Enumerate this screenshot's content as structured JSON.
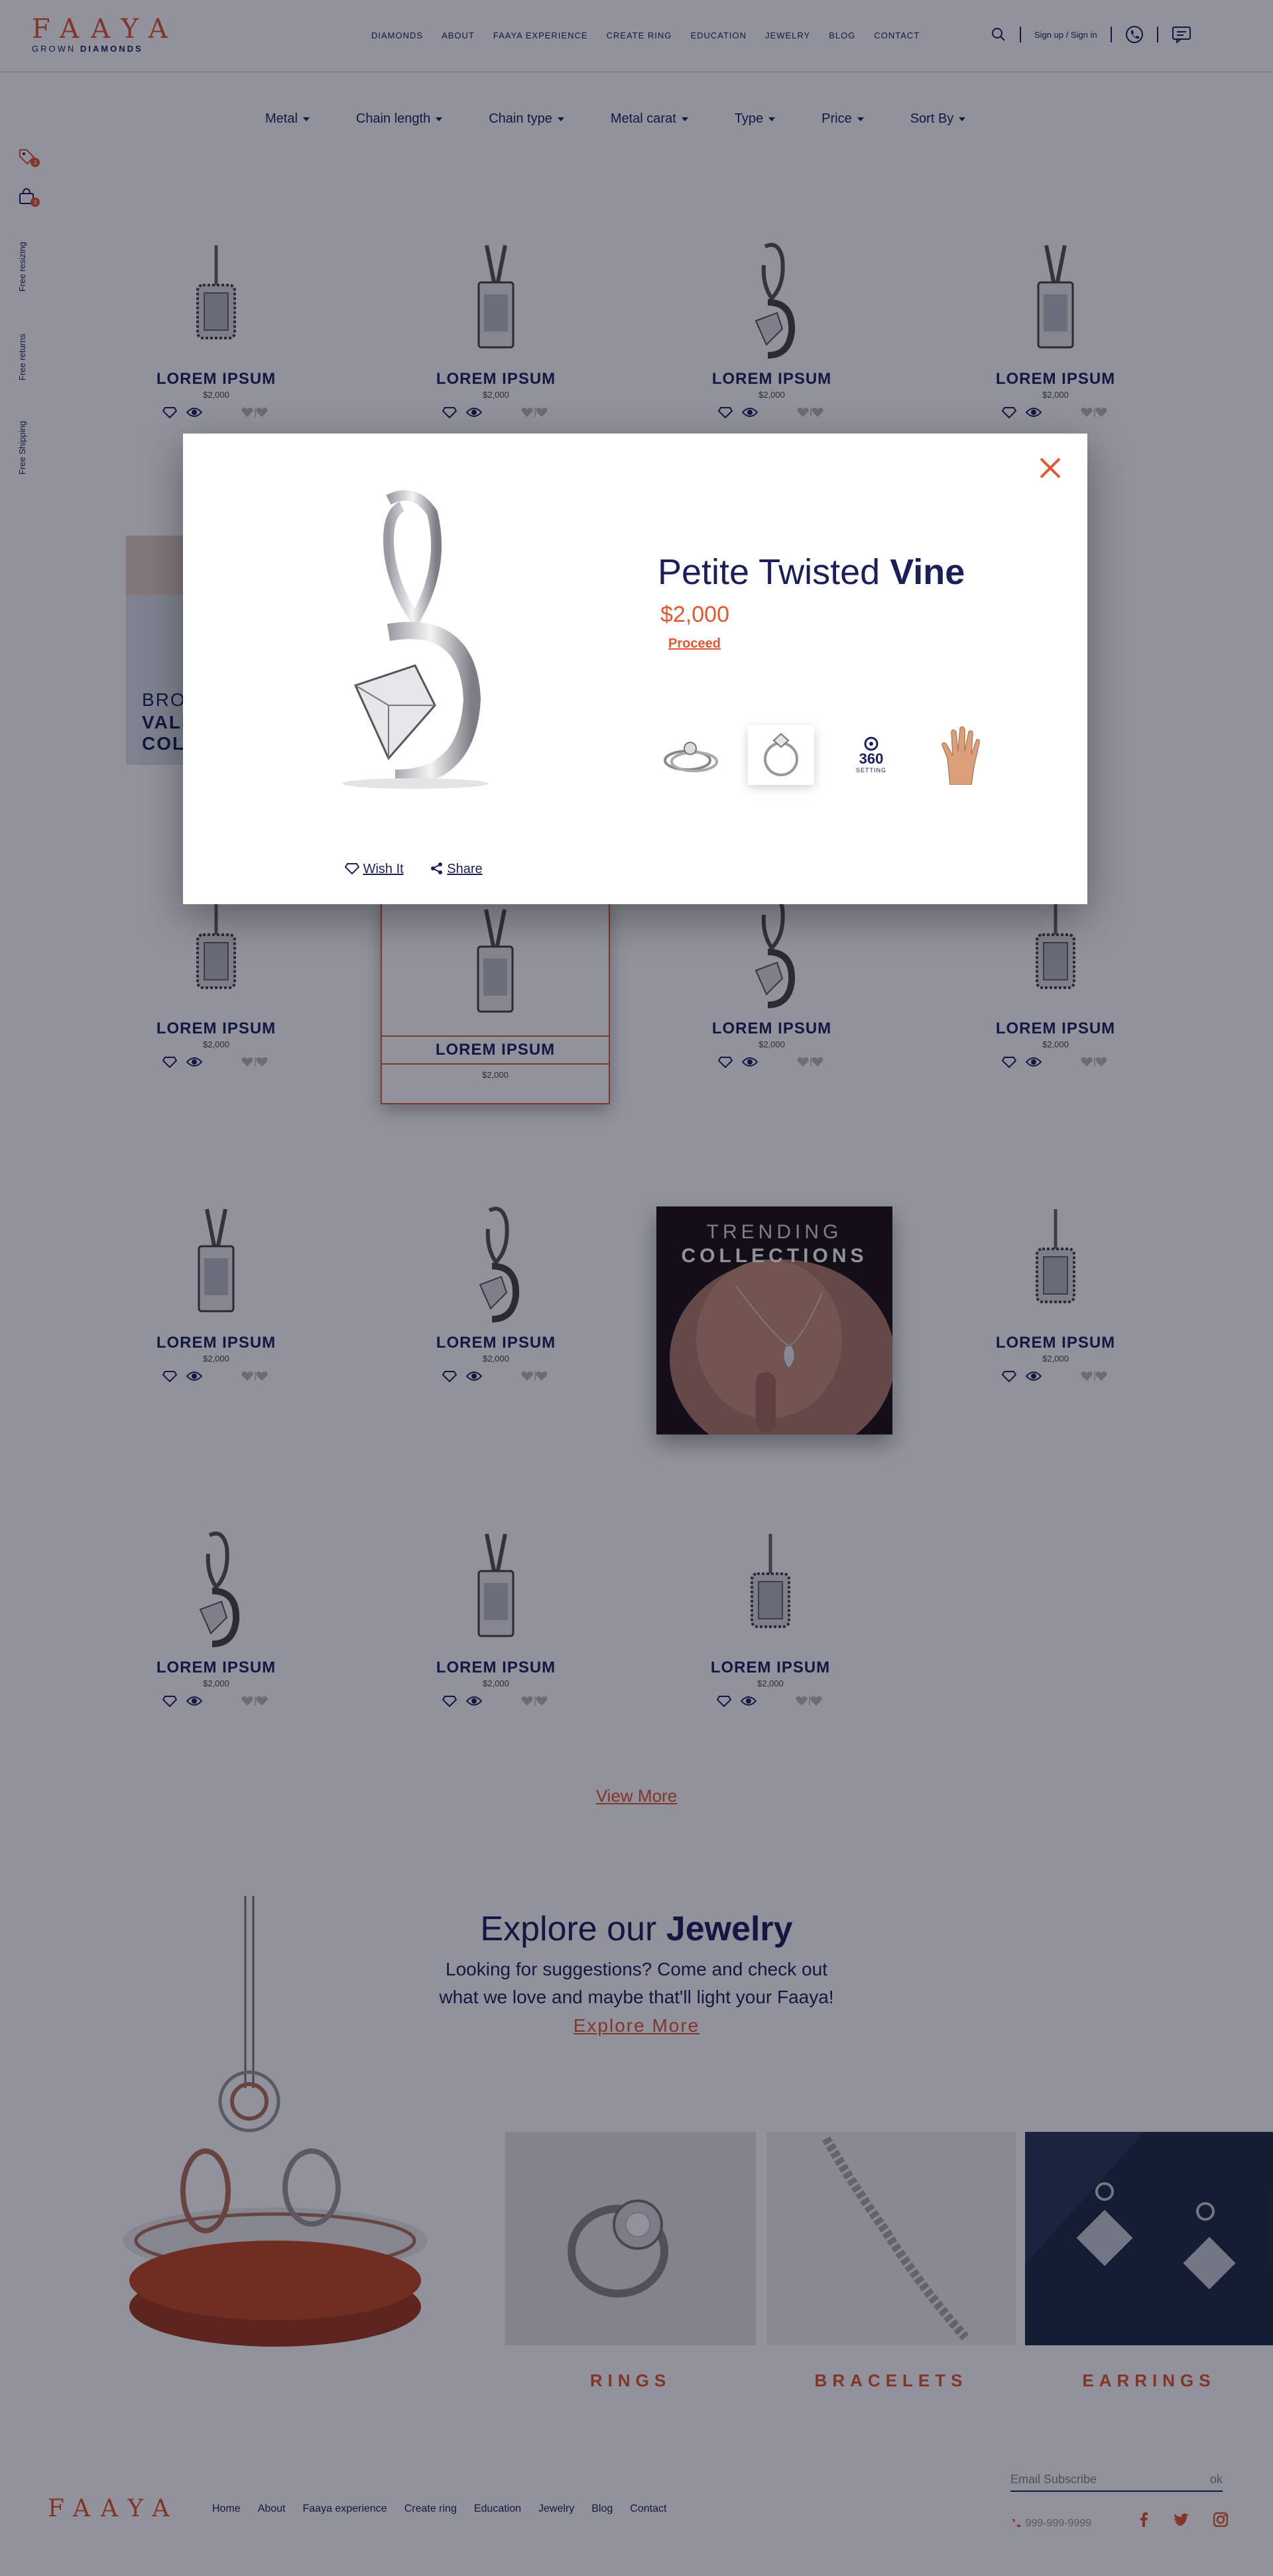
{
  "header": {
    "logo_word": "FAAYA",
    "logo_sub_1": "GROWN",
    "logo_sub_2": "DIAMONDS",
    "nav": [
      "DIAMONDS",
      "ABOUT",
      "FAAYA EXPERIENCE",
      "CREATE RING",
      "EDUCATION",
      "JEWELRY",
      "BLOG",
      "CONTACT"
    ],
    "signin_label": "Sign up / Sign in"
  },
  "filters": [
    "Metal",
    "Chain length",
    "Chain type",
    "Metal carat",
    "Type",
    "Price",
    "Sort By"
  ],
  "sidebar": {
    "wishlist_count": "3",
    "cart_count": "3",
    "labels": [
      "Free resizing",
      "Free returns",
      "Free Shipping"
    ]
  },
  "product": {
    "name": "LOREM IPSUM",
    "price": "$2,000"
  },
  "banners": {
    "valentine": [
      "BROWSE",
      "VALENTINE",
      "COLLECTION"
    ],
    "trending_1": "TRENDING",
    "trending_2": "COLLECTIONS"
  },
  "view_more": "View More",
  "explore": {
    "title_1": "Explore our",
    "title_2": "Jewelry",
    "desc_1": "Looking for suggestions? Come and check out",
    "desc_2": "what we love and maybe that'll light your Faaya!",
    "link": "Explore More",
    "categories": [
      "RINGS",
      "BRACELETS",
      "EARRINGS"
    ]
  },
  "footer": {
    "logo": "FAAYA",
    "nav": [
      "Home",
      "About",
      "Faaya experience",
      "Create ring",
      "Education",
      "Jewelry",
      "Blog",
      "Contact"
    ],
    "subscribe_placeholder": "Email Subscribe",
    "subscribe_button": "ok",
    "phone": "999-999-9999"
  },
  "modal": {
    "title_1": "Petite Twisted",
    "title_2": "Vine",
    "price": "$2,000",
    "proceed": "Proceed",
    "setting_360": "360",
    "setting_label": "SETTING",
    "wish_label": "Wish It",
    "share_label": "Share"
  },
  "colors": {
    "accent": "#e4572e",
    "navy": "#1b1f5c"
  }
}
